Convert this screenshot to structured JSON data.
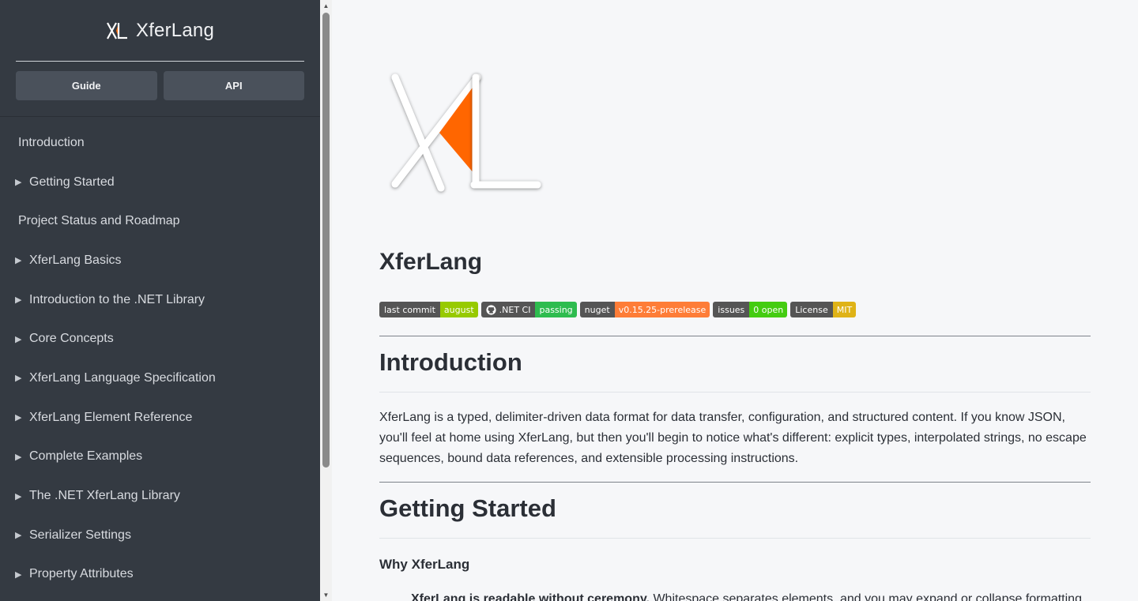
{
  "sidebar": {
    "brand_title": "XferLang",
    "buttons": {
      "guide": "Guide",
      "api": "API"
    },
    "items": [
      {
        "label": "Introduction",
        "expandable": false
      },
      {
        "label": "Getting Started",
        "expandable": true
      },
      {
        "label": "Project Status and Roadmap",
        "expandable": false
      },
      {
        "label": "XferLang Basics",
        "expandable": true
      },
      {
        "label": "Introduction to the .NET Library",
        "expandable": true
      },
      {
        "label": "Core Concepts",
        "expandable": true
      },
      {
        "label": "XferLang Language Specification",
        "expandable": true
      },
      {
        "label": "XferLang Element Reference",
        "expandable": true
      },
      {
        "label": "Complete Examples",
        "expandable": true
      },
      {
        "label": "The .NET XferLang Library",
        "expandable": true
      },
      {
        "label": "Serializer Settings",
        "expandable": true
      },
      {
        "label": "Property Attributes",
        "expandable": true
      }
    ]
  },
  "main": {
    "title": "XferLang",
    "badges": [
      {
        "label": "last commit",
        "value": "august",
        "color": "#97ca00",
        "icon": ""
      },
      {
        "label": ".NET CI",
        "value": "passing",
        "color": "#2ebc4f",
        "icon": "github-icon"
      },
      {
        "label": "nuget",
        "value": "v0.15.25-prerelease",
        "color": "#fe7d37",
        "icon": ""
      },
      {
        "label": "issues",
        "value": "0 open",
        "color": "#4c1",
        "icon": ""
      },
      {
        "label": "License",
        "value": "MIT",
        "color": "#dfb317",
        "icon": ""
      }
    ],
    "intro_heading": "Introduction",
    "intro_text": "XferLang is a typed, delimiter-driven data format for data transfer, configuration, and structured content. If you know JSON, you'll feel at home using XferLang, but then you'll begin to notice what's different: explicit types, interpolated strings, no escape sequences, bound data references, and extensible processing instructions.",
    "getting_started_heading": "Getting Started",
    "why_heading": "Why XferLang",
    "first_point_bold": "XferLang is readable without ceremony.",
    "first_point_text": " Whitespace separates elements, and you may expand or collapse formatting"
  },
  "colors": {
    "accent": "#ff6600",
    "sidebar_bg": "#343a42"
  }
}
